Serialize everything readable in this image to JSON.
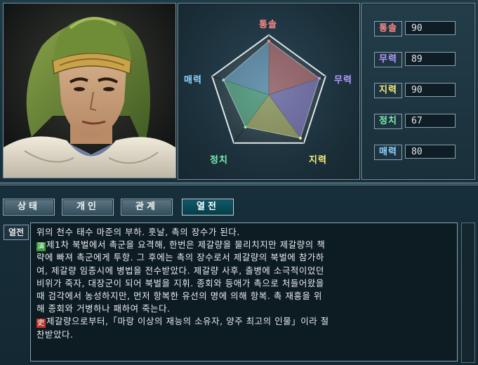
{
  "radar": {
    "labels": {
      "command": "통솔",
      "war": "무력",
      "intelligence": "지력",
      "politics": "정치",
      "charm": "매력"
    },
    "colors": {
      "command": "#ff8a8a",
      "war": "#b39dff",
      "intelligence": "#f4f07a",
      "politics": "#7df0b0",
      "charm": "#8fd4ff"
    },
    "max": 100
  },
  "stats": [
    {
      "name": "통솔",
      "value": 90,
      "color": "#ff8a8a"
    },
    {
      "name": "무력",
      "value": 89,
      "color": "#b39dff"
    },
    {
      "name": "지력",
      "value": 90,
      "color": "#f4f07a"
    },
    {
      "name": "정치",
      "value": 67,
      "color": "#7df0b0"
    },
    {
      "name": "매력",
      "value": 80,
      "color": "#8fd4ff"
    }
  ],
  "tabs": [
    {
      "label": "상태",
      "active": false
    },
    {
      "label": "개인",
      "active": false
    },
    {
      "label": "관계",
      "active": false
    },
    {
      "label": "열전",
      "active": true
    }
  ],
  "bio": {
    "label": "열전",
    "lines": [
      "위의 천수 태수 마준의 부하. 훗날, 촉의 장수가 된다.",
      "제1차 북벌에서 촉군을 요격해, 한번은 제갈량을 물리치지만 제갈량의 책",
      "략에 빠져 촉군에게 투항. 그 후에는 촉의 장수로서 제갈량의 북벌에 참가하",
      "여, 제갈량 임종시에 병법을 전수받았다. 제갈량 사후, 출병에 소극적이었던",
      "비위가 죽자, 대장군이 되어 북벌을 지휘. 종회와 등애가 촉으로 처들어왔을",
      "때 검각에서 농성하지만, 먼저 항복한 유선의 명에 의해 항복. 촉 재흥을 위",
      "해 종회와 거병하나 패하여 죽는다.",
      "제갈량으로부터,「마랑 이상의 재능의 소유자, 양주 최고의 인물」이라 절",
      "찬받았다."
    ],
    "marks": {
      "1": {
        "glyph": "演",
        "color": "#3b9a3b"
      },
      "7": {
        "glyph": "史",
        "color": "#c0392b"
      }
    }
  }
}
